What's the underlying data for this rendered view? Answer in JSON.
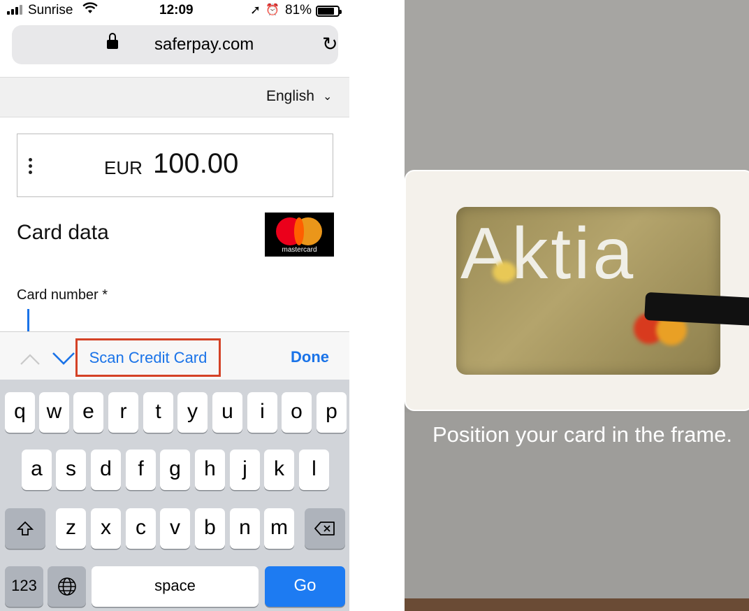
{
  "status_bar": {
    "carrier": "Sunrise",
    "time": "12:09",
    "battery": "81%",
    "battery_level": 0.81
  },
  "browser": {
    "host": "saferpay.com"
  },
  "language": {
    "selected": "English"
  },
  "payment": {
    "currency": "EUR",
    "amount": "100.00",
    "card_title": "Card data",
    "card_brand_label": "mastercard",
    "card_number_label": "Card number *"
  },
  "accessory_bar": {
    "scan_label": "Scan Credit Card",
    "done_label": "Done"
  },
  "keyboard": {
    "row1": [
      "q",
      "w",
      "e",
      "r",
      "t",
      "y",
      "u",
      "i",
      "o",
      "p"
    ],
    "row2": [
      "a",
      "s",
      "d",
      "f",
      "g",
      "h",
      "j",
      "k",
      "l"
    ],
    "row3": [
      "z",
      "x",
      "c",
      "v",
      "b",
      "n",
      "m"
    ],
    "numbers_key": "123",
    "space_key": "space",
    "go_key": "Go"
  },
  "scanner": {
    "card_text": "Aktia",
    "instruction": "Position your card in the frame."
  },
  "colors": {
    "ios_blue": "#1a73e8",
    "highlight_red": "#d44226",
    "go_key": "#1d7bf2",
    "keyboard_bg": "#d1d4d9"
  }
}
